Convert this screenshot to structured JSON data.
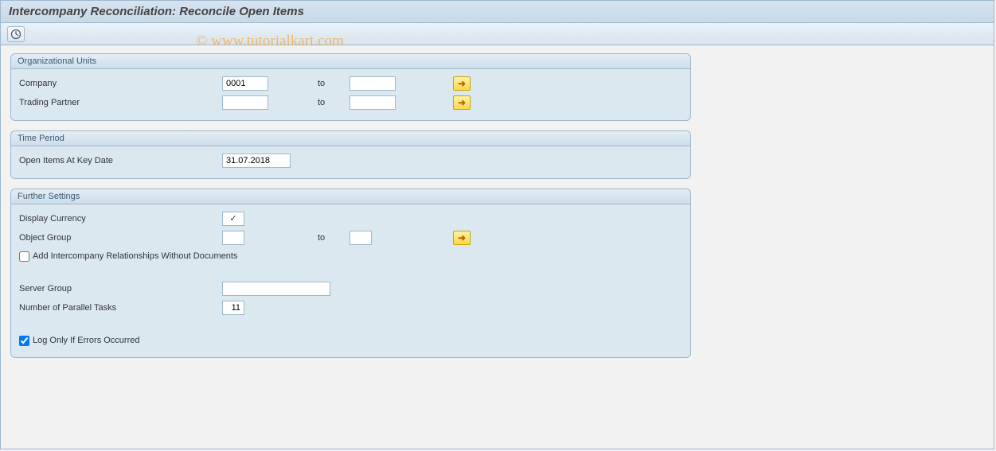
{
  "title": "Intercompany Reconciliation: Reconcile Open Items",
  "watermark": "© www.tutorialkart.com",
  "groups": {
    "org": {
      "title": "Organizational Units",
      "company_label": "Company",
      "company_value": "0001",
      "company_to_label": "to",
      "company_to_value": "",
      "trading_label": "Trading Partner",
      "trading_value": "",
      "trading_to_label": "to",
      "trading_to_value": ""
    },
    "time": {
      "title": "Time Period",
      "keydate_label": "Open Items At Key Date",
      "keydate_value": "31.07.2018"
    },
    "further": {
      "title": "Further Settings",
      "display_currency_label": "Display Currency",
      "display_currency_checked": true,
      "object_group_label": "Object Group",
      "object_group_value": "",
      "object_group_to_label": "to",
      "object_group_to_value": "",
      "add_rel_label": "Add Intercompany Relationships Without Documents",
      "add_rel_checked": false,
      "server_group_label": "Server Group",
      "server_group_value": "",
      "parallel_label": "Number of Parallel Tasks",
      "parallel_value": "11",
      "log_label": "Log Only If Errors Occurred",
      "log_checked": true
    }
  }
}
